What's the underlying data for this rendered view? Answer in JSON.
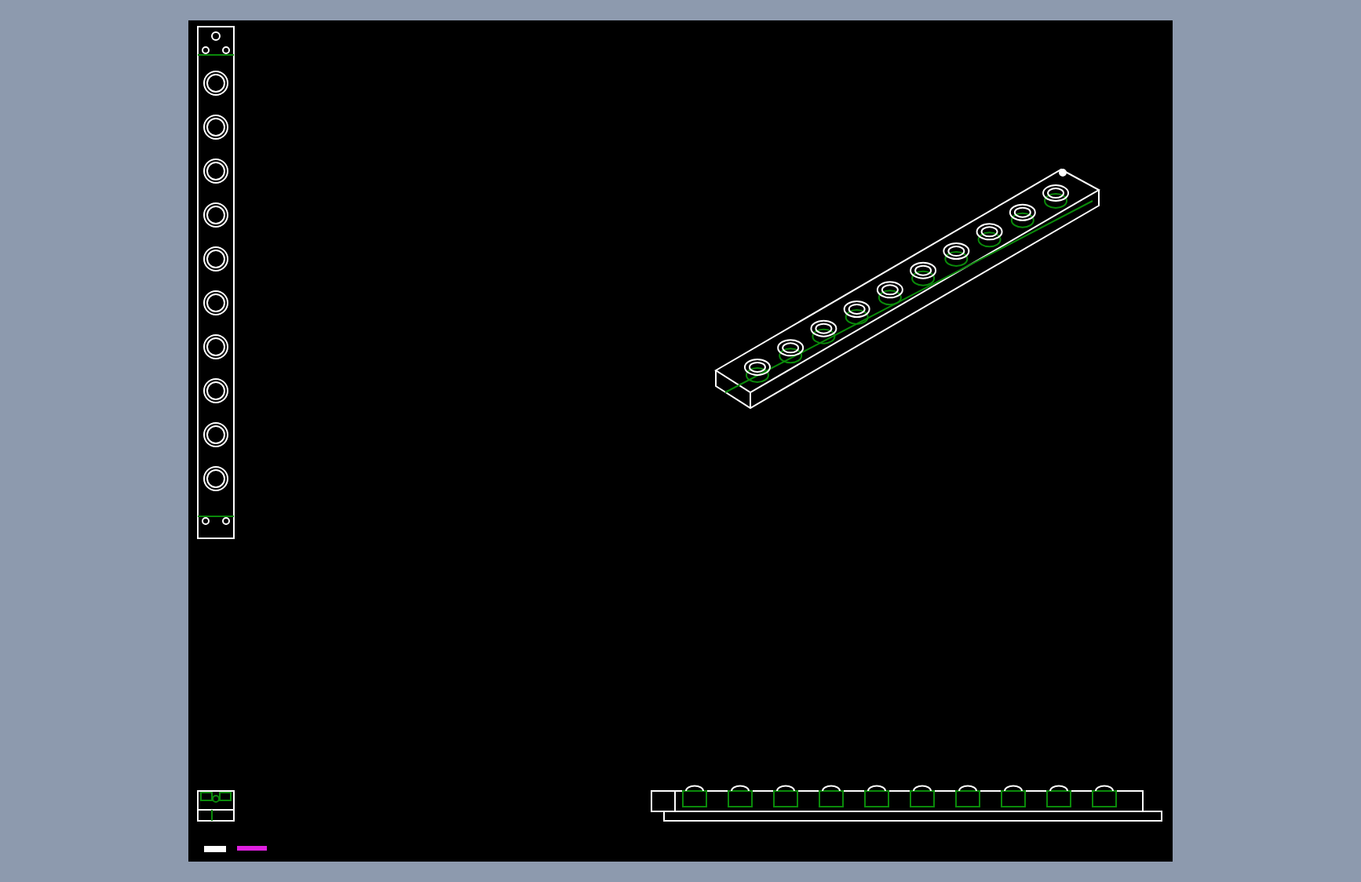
{
  "drawing": {
    "views": [
      {
        "kind": "plan"
      },
      {
        "kind": "isometric"
      },
      {
        "kind": "end"
      },
      {
        "kind": "side"
      },
      {
        "kind": "title_marks"
      }
    ]
  }
}
